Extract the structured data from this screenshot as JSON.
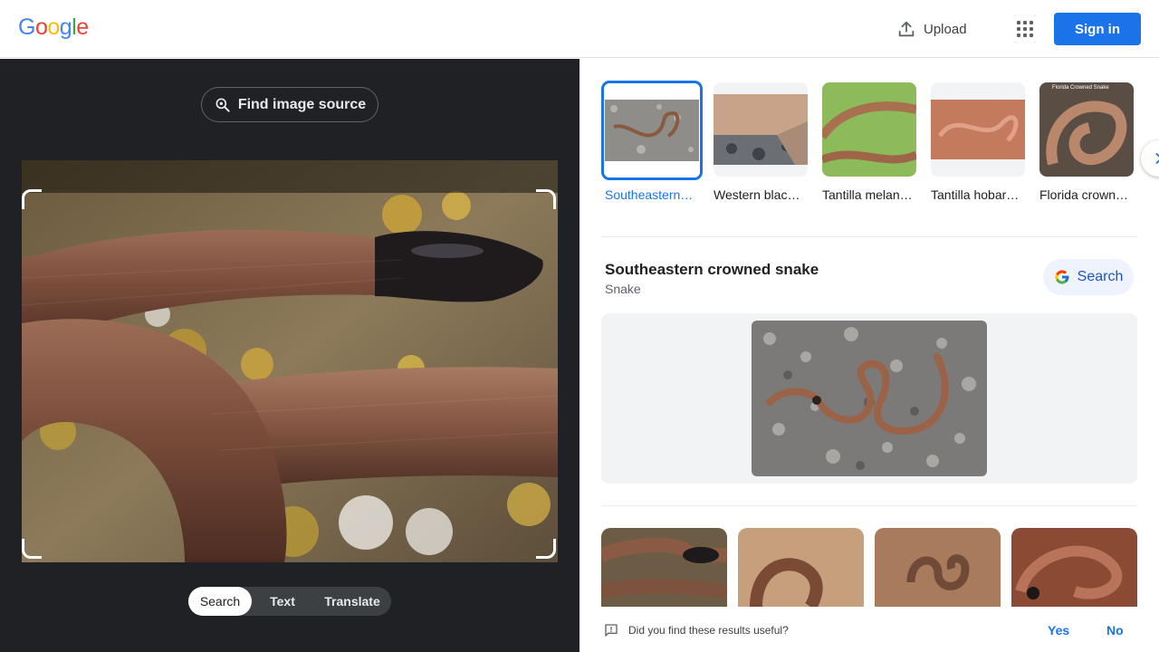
{
  "header": {
    "logo_letters": [
      {
        "ch": "G",
        "color": "#4285F4"
      },
      {
        "ch": "o",
        "color": "#EA4335"
      },
      {
        "ch": "o",
        "color": "#FBBC05"
      },
      {
        "ch": "g",
        "color": "#4285F4"
      },
      {
        "ch": "l",
        "color": "#34A853"
      },
      {
        "ch": "e",
        "color": "#EA4335"
      }
    ],
    "upload_label": "Upload",
    "upload_icon": "upload-icon",
    "apps_icon": "apps-grid-icon",
    "signin_label": "Sign in"
  },
  "left": {
    "find_source_label": "Find image source",
    "find_source_icon": "lens-search-icon",
    "modes": [
      "Search",
      "Text",
      "Translate"
    ],
    "active_mode": "Search"
  },
  "right": {
    "matches": [
      {
        "label": "Southeastern crowned...",
        "selected": true
      },
      {
        "label": "Western black-heade...",
        "selected": false
      },
      {
        "label": "Tantilla melanoceph...",
        "selected": false
      },
      {
        "label": "Tantilla hobartsmithi",
        "selected": false
      },
      {
        "label": "Florida crowned...",
        "selected": false
      }
    ],
    "thumb_overlay_text": "Florida Crowned Snake",
    "next_icon": "chevron-right-icon",
    "entity": {
      "title": "Southeastern crowned snake",
      "subtitle": "Snake",
      "search_label": "Search",
      "search_icon": "google-g-icon"
    },
    "feedback": {
      "question": "Did you find these results useful?",
      "yes": "Yes",
      "no": "No",
      "icon": "feedback-icon"
    }
  },
  "colors": {
    "accent": "#1a73e8",
    "dark_bg": "#202124",
    "mode_bar": "#3c4043"
  }
}
